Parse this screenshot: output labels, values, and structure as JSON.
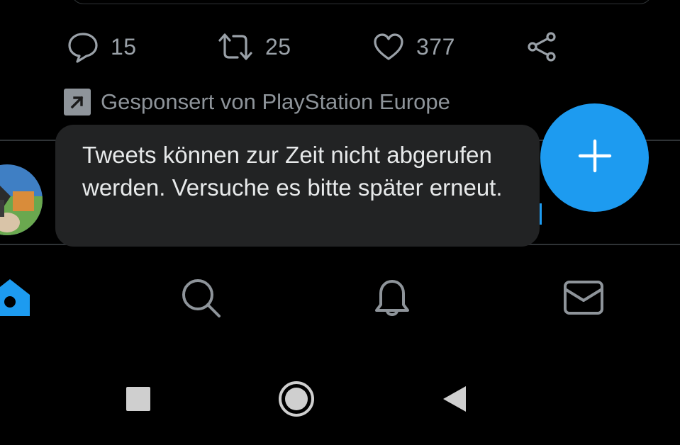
{
  "tweet_actions": {
    "reply_count": "15",
    "retweet_count": "25",
    "like_count": "377"
  },
  "promoted": {
    "label": "Gesponsert von PlayStation Europe"
  },
  "toast": {
    "message": "Tweets können zur Zeit nicht abgerufen werden. Versuche es bitte später erneut."
  },
  "bottom_nav": {
    "tabs": [
      {
        "icon": "home-icon",
        "active": true
      },
      {
        "icon": "search-icon",
        "active": false
      },
      {
        "icon": "notifications-icon",
        "active": false
      },
      {
        "icon": "messages-icon",
        "active": false
      }
    ]
  },
  "system_nav": {
    "buttons": [
      "recents-icon",
      "home-circle-icon",
      "back-icon"
    ]
  },
  "colors": {
    "accent": "#1d9bf0",
    "background": "#000000",
    "muted_text": "#8b9299",
    "toast_bg": "#222324"
  }
}
